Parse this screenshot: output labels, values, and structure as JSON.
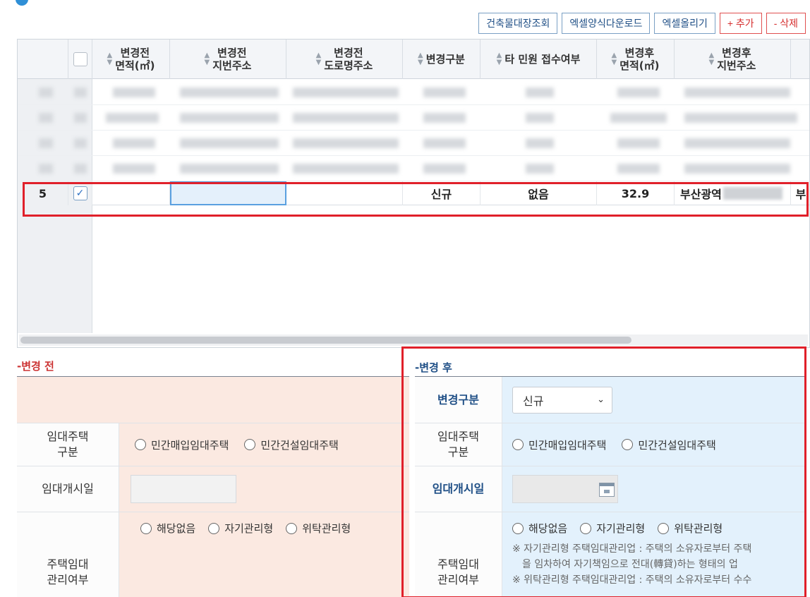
{
  "toolbar": {
    "building_lookup": "건축물대장조회",
    "excel_download": "엑셀양식다운로드",
    "excel_upload": "엑셀올리기",
    "add": "+ 추가",
    "delete": "- 삭제"
  },
  "grid": {
    "headers": {
      "area_before": [
        "변경전",
        "면적(㎡)"
      ],
      "lot_before": [
        "변경전",
        "지번주소"
      ],
      "road_before": [
        "변경전",
        "도로명주소"
      ],
      "change_type": "변경구분",
      "other_petition": "타 민원 접수여부",
      "area_after": [
        "변경후",
        "면적(㎡)"
      ],
      "lot_after": [
        "변경후",
        "지번주소"
      ]
    },
    "selected_row": {
      "no": "5",
      "checked": true,
      "change_type": "신규",
      "other_petition": "없음",
      "area_after": "32.9",
      "lot_after": "부산광역",
      "overflow": "부"
    },
    "horizontal_scroll": 0.0
  },
  "before": {
    "section_title": "-변경 전",
    "rental_type_label": [
      "임대주택",
      "구분"
    ],
    "rental_options": [
      "민간매입임대주택",
      "민간건설임대주택"
    ],
    "start_date_label": "임대개시일",
    "mgmt_label": [
      "주택임대",
      "관리여부"
    ],
    "mgmt_options": [
      "해당없음",
      "자기관리형",
      "위탁관리형"
    ]
  },
  "after": {
    "section_title": "-변경 후",
    "change_type_label": "변경구분",
    "change_type_value": "신규",
    "rental_type_label": [
      "임대주택",
      "구분"
    ],
    "rental_options": [
      "민간매입임대주택",
      "민간건설임대주택"
    ],
    "start_date_label": "임대개시일",
    "mgmt_label": [
      "주택임대",
      "관리여부"
    ],
    "mgmt_options": [
      "해당없음",
      "자기관리형",
      "위탁관리형"
    ],
    "notes": [
      "※ 자기관리형 주택임대관리업 : 주택의 소유자로부터 주택",
      "을 임차하여 자기책임으로 전대(轉貸)하는 형태의 업",
      "※ 위탁관리형 주택임대관리업 : 주택의 소유자로부터 수수"
    ]
  },
  "colors": {
    "highlight_red": "#e0202a",
    "before_bg": "#fbe9e1",
    "after_bg": "#e3f1fc",
    "title_red": "#cc3333",
    "title_blue": "#1f4f86"
  }
}
